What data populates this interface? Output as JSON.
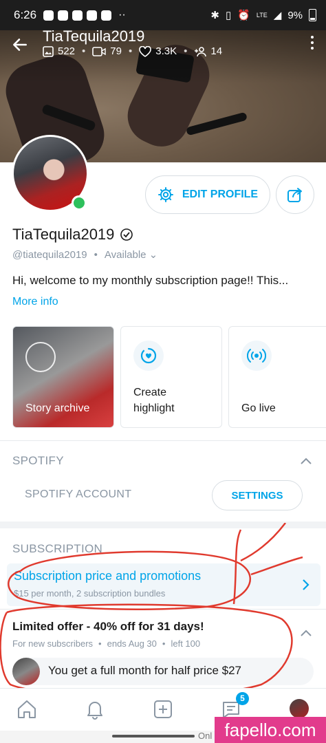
{
  "status_bar": {
    "time": "6:26",
    "more": "··",
    "battery": "9%",
    "network": "LTE"
  },
  "header": {
    "title": "TiaTequila2019",
    "stats": {
      "photos": "522",
      "videos": "79",
      "likes": "3.3K",
      "fans": "14"
    }
  },
  "profile": {
    "name": "TiaTequila2019",
    "handle": "@tiatequila2019",
    "availability": "Available",
    "bio": "Hi, welcome to my monthly subscription page!! This...",
    "more_info": "More info",
    "edit_button": "EDIT PROFILE"
  },
  "highlights": [
    {
      "label": "Story archive"
    },
    {
      "label": "Create highlight"
    },
    {
      "label": "Go live"
    }
  ],
  "spotify": {
    "title": "SPOTIFY",
    "account_label": "SPOTIFY ACCOUNT",
    "settings_button": "SETTINGS"
  },
  "subscription": {
    "title": "SUBSCRIPTION",
    "price_title": "Subscription price and promotions",
    "price_desc": "$15 per month, 2 subscription bundles"
  },
  "limited_offer": {
    "title": "Limited offer - 40% off for 31 days!",
    "meta": [
      "For new subscribers",
      "ends Aug 30",
      "left 100"
    ],
    "message": "You get a full month for half price $27"
  },
  "nav": {
    "messages_badge": "5"
  },
  "footer": {
    "partial_text": "Onl",
    "watermark": "fapello.com"
  },
  "colors": {
    "accent": "#00a4e8",
    "online": "#2ec05c",
    "annotation": "#e03a2e",
    "watermark": "#e23b8c"
  }
}
